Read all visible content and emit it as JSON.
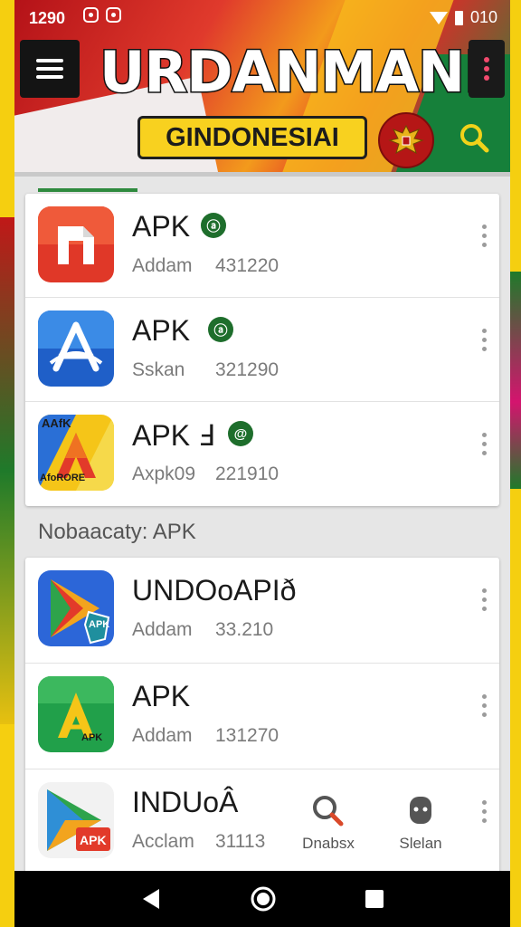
{
  "status_bar": {
    "time": "1290",
    "right_text": "010"
  },
  "header": {
    "app_title": "URDANMANI",
    "country_badge": "GINDONESIAI"
  },
  "list_primary": [
    {
      "name": "APK",
      "badge": "ⓐ",
      "developer": "Addam",
      "count": "431220",
      "icon": "brand-n-icon"
    },
    {
      "name": "APK",
      "badge": "ⓐ",
      "developer": "Sskan",
      "count": "321290",
      "icon": "app-store-icon"
    },
    {
      "name": "APK Ⅎ",
      "badge": "@",
      "developer": "Axpk09",
      "count": "221910",
      "icon": "apk-a-icon",
      "icon_text_top": "AAfK",
      "icon_text_bottom": "AfoRORE"
    }
  ],
  "section_label": "Nobaacaty: APK",
  "list_secondary": [
    {
      "name": "UNDOoAPIð",
      "developer": "Addam",
      "count": "33.210",
      "icon": "play-apk-icon",
      "icon_text": "APK"
    },
    {
      "name": "APK",
      "developer": "Addam",
      "count": "131270",
      "icon": "green-a-icon",
      "icon_text": "APK"
    },
    {
      "name": "INDUoÂ",
      "developer": "Acclam",
      "count": "31113",
      "icon": "play-apk-icon",
      "icon_text": "APK"
    }
  ],
  "floating_actions": {
    "search_label": "Dnabsx",
    "profile_label": "Slelan"
  },
  "colors": {
    "frame_yellow": "#f5cf10",
    "flag_red": "#c81822",
    "green": "#1e6e2c",
    "badge_yellow": "#f8d11f"
  }
}
